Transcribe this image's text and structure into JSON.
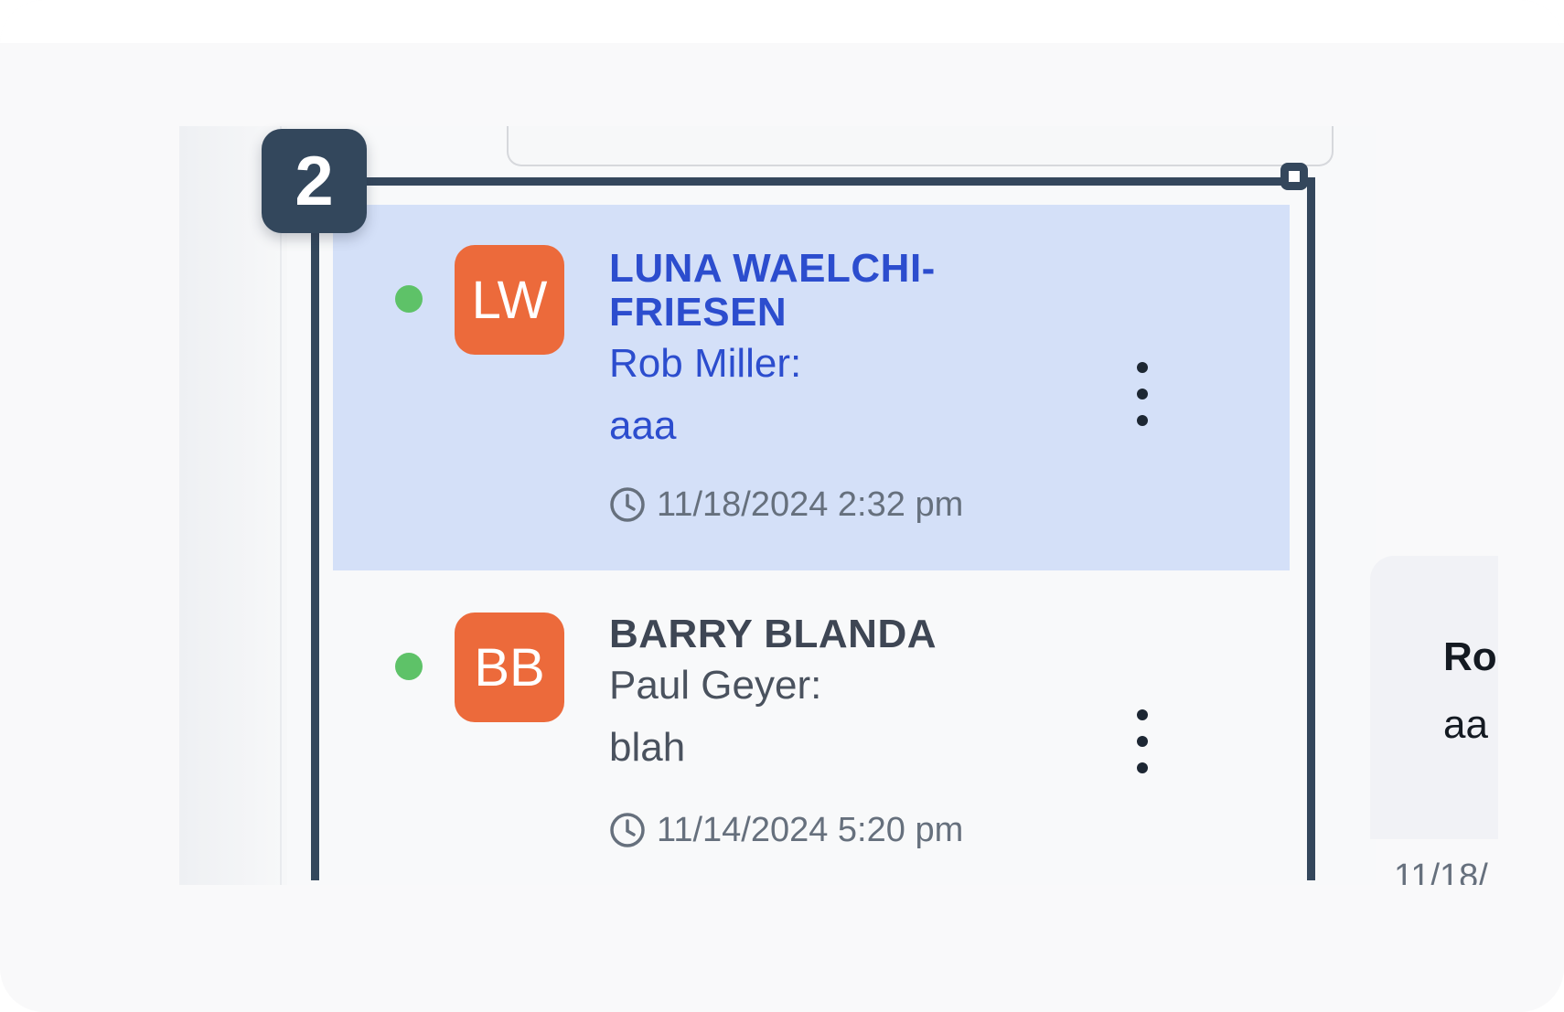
{
  "conversations": [
    {
      "initials": "LW",
      "name_line1": "LUNA WAELCHI-",
      "name_line2": "FRIESEN",
      "sender": "Rob Miller:",
      "message": "aaa",
      "timestamp": "11/18/2024 2:32 pm",
      "online": true,
      "selected": true
    },
    {
      "initials": "BB",
      "name_line1": "BARRY BLANDA",
      "sender": "Paul Geyer:",
      "message": "blah",
      "timestamp": "11/14/2024 5:20 pm",
      "online": true,
      "selected": false
    }
  ],
  "detail": {
    "name_partial": "Ro",
    "message_partial": "aa",
    "timestamp_partial": "11/18/"
  },
  "annotation": {
    "badge_number": "2"
  },
  "colors": {
    "selected_bg": "#d4e0f8",
    "selected_text": "#2c4dce",
    "avatar_bg": "#ec6a3b",
    "online_dot": "#5ec268",
    "annotation": "#34475c"
  },
  "icons": [
    "clock-icon",
    "more-vertical-icon"
  ]
}
